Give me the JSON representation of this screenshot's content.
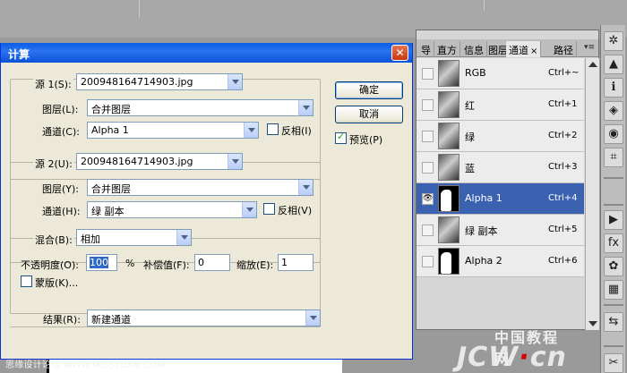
{
  "dialog": {
    "title": "计算",
    "close_glyph": "✕",
    "source1": {
      "label": "源 1(S):",
      "file": "200948164714903.jpg",
      "layer_label": "图层(L):",
      "layer_value": "合并图层",
      "channel_label": "通道(C):",
      "channel_value": "Alpha 1",
      "invert_label": "反相(I)",
      "invert_checked": false
    },
    "source2": {
      "label": "源 2(U):",
      "file": "200948164714903.jpg",
      "layer_label": "图层(Y):",
      "layer_value": "合并图层",
      "channel_label": "通道(H):",
      "channel_value": "绿 副本",
      "invert_label": "反相(V)",
      "invert_checked": false
    },
    "blend": {
      "label": "混合(B):",
      "value": "相加",
      "opacity_label": "不透明度(O):",
      "opacity_value": "100",
      "percent": "%",
      "offset_label": "补偿值(F):",
      "offset_value": "0",
      "scale_label": "缩放(E):",
      "scale_value": "1",
      "mask_label": "蒙版(K)..."
    },
    "result": {
      "label": "结果(R):",
      "value": "新建通道"
    },
    "buttons": {
      "ok": "确定",
      "cancel": "取消",
      "preview": "预览(P)",
      "preview_checked": true
    }
  },
  "panel": {
    "tabs": [
      "导",
      "直方",
      "信息",
      "图层",
      "通道",
      "路径"
    ],
    "active_tab": "通道",
    "tab_close": "×",
    "menu_glyph": "▾≡",
    "channels": [
      {
        "name": "RGB",
        "shortcut": "Ctrl+~",
        "thumb": "photo",
        "selected": false,
        "visible": false
      },
      {
        "name": "红",
        "shortcut": "Ctrl+1",
        "thumb": "photo",
        "selected": false,
        "visible": false
      },
      {
        "name": "绿",
        "shortcut": "Ctrl+2",
        "thumb": "photo",
        "selected": false,
        "visible": false
      },
      {
        "name": "蓝",
        "shortcut": "Ctrl+3",
        "thumb": "photo",
        "selected": false,
        "visible": false
      },
      {
        "name": "Alpha 1",
        "shortcut": "Ctrl+4",
        "thumb": "mask",
        "selected": true,
        "visible": true
      },
      {
        "name": "绿 副本",
        "shortcut": "Ctrl+5",
        "thumb": "photo",
        "selected": false,
        "visible": false
      },
      {
        "name": "Alpha 2",
        "shortcut": "Ctrl+6",
        "thumb": "mask",
        "selected": false,
        "visible": false
      }
    ],
    "eye_glyph": "👁"
  },
  "toolbar": {
    "tools": [
      {
        "name": "navigator-icon",
        "glyph": "✲"
      },
      {
        "name": "histogram-icon",
        "glyph": "▲"
      },
      {
        "name": "info-icon",
        "glyph": "ℹ"
      },
      {
        "name": "layers-icon",
        "glyph": "◈"
      },
      {
        "name": "channels-icon",
        "glyph": "◉"
      },
      {
        "name": "paths-icon",
        "glyph": "⌗"
      },
      {
        "name": "actions-icon",
        "glyph": "▶"
      },
      {
        "name": "styles-icon",
        "glyph": "fx"
      },
      {
        "name": "swatches-icon",
        "glyph": "✿"
      },
      {
        "name": "grid-icon",
        "glyph": "▦"
      },
      {
        "name": "history-icon",
        "glyph": "⇆"
      },
      {
        "name": "tool-presets-icon",
        "glyph": "✂"
      }
    ]
  },
  "watermarks": {
    "left": "思缘设计论坛 WWW.MISSYUAN.COM",
    "right_main": "JCW",
    "right_dot": "·",
    "right_end": "cn",
    "right_sub": "中国教程网"
  },
  "colors": {
    "selection": "#3a62b1",
    "titlebar": "#0a5ee3",
    "dialog_bg": "#ece9d8"
  }
}
